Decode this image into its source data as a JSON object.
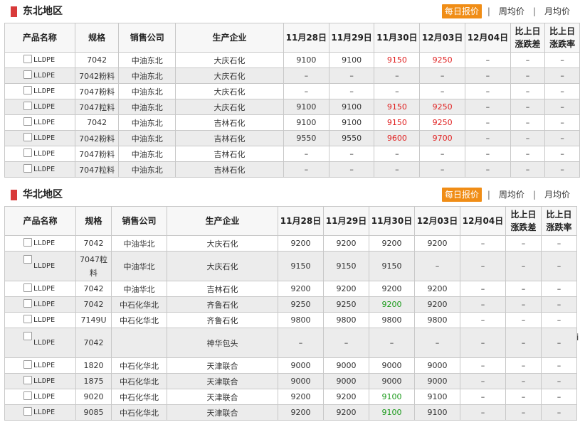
{
  "tabs": {
    "daily": "每日报价",
    "weekly": "周均价",
    "monthly": "月均价"
  },
  "columns": [
    "产品名称",
    "规格",
    "销售公司",
    "生产企业",
    "11月28日",
    "11月29日",
    "11月30日",
    "12月03日",
    "12月04日",
    "比上日涨跌差",
    "比上日涨跌率"
  ],
  "column_parts": {
    "diff": [
      "比上日",
      "涨跌差"
    ],
    "rate": [
      "比上日",
      "涨跌率"
    ]
  },
  "northeast": {
    "title": "东北地区",
    "rows": [
      {
        "name": "LLDPE",
        "spec": "7042",
        "seller": "中油东北",
        "producer": "大庆石化",
        "d1": "9100",
        "d2": "9100",
        "d3": "9150",
        "d4": "9250",
        "d5": "–",
        "diff": "–",
        "rate": "–"
      },
      {
        "name": "LLDPE",
        "spec": "7042粉料",
        "seller": "中油东北",
        "producer": "大庆石化",
        "d1": "–",
        "d2": "–",
        "d3": "–",
        "d4": "–",
        "d5": "–",
        "diff": "–",
        "rate": "–"
      },
      {
        "name": "LLDPE",
        "spec": "7047粉料",
        "seller": "中油东北",
        "producer": "大庆石化",
        "d1": "–",
        "d2": "–",
        "d3": "–",
        "d4": "–",
        "d5": "–",
        "diff": "–",
        "rate": "–"
      },
      {
        "name": "LLDPE",
        "spec": "7047粒料",
        "seller": "中油东北",
        "producer": "大庆石化",
        "d1": "9100",
        "d2": "9100",
        "d3": "9150",
        "d4": "9250",
        "d5": "–",
        "diff": "–",
        "rate": "–"
      },
      {
        "name": "LLDPE",
        "spec": "7042",
        "seller": "中油东北",
        "producer": "吉林石化",
        "d1": "9100",
        "d2": "9100",
        "d3": "9150",
        "d4": "9250",
        "d5": "–",
        "diff": "–",
        "rate": "–"
      },
      {
        "name": "LLDPE",
        "spec": "7042粉料",
        "seller": "中油东北",
        "producer": "吉林石化",
        "d1": "9550",
        "d2": "9550",
        "d3": "9600",
        "d4": "9700",
        "d5": "–",
        "diff": "–",
        "rate": "–"
      },
      {
        "name": "LLDPE",
        "spec": "7047粉料",
        "seller": "中油东北",
        "producer": "吉林石化",
        "d1": "–",
        "d2": "–",
        "d3": "–",
        "d4": "–",
        "d5": "–",
        "diff": "–",
        "rate": "–"
      },
      {
        "name": "LLDPE",
        "spec": "7047粒料",
        "seller": "中油东北",
        "producer": "吉林石化",
        "d1": "–",
        "d2": "–",
        "d3": "–",
        "d4": "–",
        "d5": "–",
        "diff": "–",
        "rate": "–"
      }
    ]
  },
  "north": {
    "title": "华北地区",
    "rows": [
      {
        "name": "LLDPE",
        "spec": "7042",
        "seller": "中油华北",
        "producer": "大庆石化",
        "d1": "9200",
        "d2": "9200",
        "d3": "9200",
        "d4": "9200",
        "d5": "–",
        "diff": "–",
        "rate": "–"
      },
      {
        "name": "LLDPE",
        "spec": "7047粒料",
        "seller": "中油华北",
        "producer": "大庆石化",
        "d1": "9150",
        "d2": "9150",
        "d3": "9150",
        "d4": "–",
        "d5": "–",
        "diff": "–",
        "rate": "–"
      },
      {
        "name": "LLDPE",
        "spec": "7042",
        "seller": "中油华北",
        "producer": "吉林石化",
        "d1": "9200",
        "d2": "9200",
        "d3": "9200",
        "d4": "9200",
        "d5": "–",
        "diff": "–",
        "rate": "–"
      },
      {
        "name": "LLDPE",
        "spec": "7042",
        "seller": "中石化华北",
        "producer": "齐鲁石化",
        "d1": "9250",
        "d2": "9250",
        "d3": "9200",
        "d4": "9200",
        "d5": "–",
        "diff": "–",
        "rate": "–"
      },
      {
        "name": "LLDPE",
        "spec": "7149U",
        "seller": "中石化华北",
        "producer": "齐鲁石化",
        "d1": "9800",
        "d2": "9800",
        "d3": "9800",
        "d4": "9800",
        "d5": "–",
        "diff": "–",
        "rate": "–"
      },
      {
        "name": "LLDPE",
        "spec": "7042",
        "seller": "",
        "producer": "神华包头",
        "d1": "–",
        "d2": "–",
        "d3": "–",
        "d4": "–",
        "d5": "–",
        "diff": "–",
        "rate": "–"
      },
      {
        "name": "LLDPE",
        "spec": "1820",
        "seller": "中石化华北",
        "producer": "天津联合",
        "d1": "9000",
        "d2": "9000",
        "d3": "9000",
        "d4": "9000",
        "d5": "–",
        "diff": "–",
        "rate": "–"
      },
      {
        "name": "LLDPE",
        "spec": "1875",
        "seller": "中石化华北",
        "producer": "天津联合",
        "d1": "9000",
        "d2": "9000",
        "d3": "9000",
        "d4": "9000",
        "d5": "–",
        "diff": "–",
        "rate": "–"
      },
      {
        "name": "LLDPE",
        "spec": "9020",
        "seller": "中石化华北",
        "producer": "天津联合",
        "d1": "9200",
        "d2": "9200",
        "d3": "9100",
        "d4": "9100",
        "d5": "–",
        "diff": "–",
        "rate": "–"
      },
      {
        "name": "LLDPE",
        "spec": "9085",
        "seller": "中石化华北",
        "producer": "天津联合",
        "d1": "9200",
        "d2": "9200",
        "d3": "9100",
        "d4": "9100",
        "d5": "–",
        "diff": "–",
        "rate": "–"
      }
    ]
  },
  "overflow_char": "i",
  "colors": {
    "accent": "#f08d16",
    "marker": "#d83a3a",
    "up": "#e02020",
    "down": "#1a9a1a",
    "alt_row": "#ececec"
  }
}
